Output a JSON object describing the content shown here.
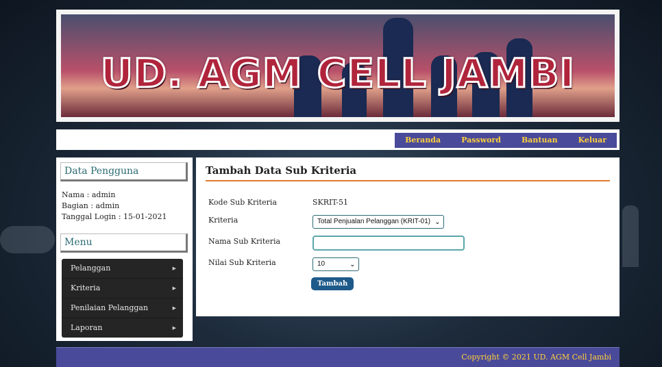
{
  "banner": {
    "title": "UD. AGM CELL JAMBI"
  },
  "nav": {
    "items": [
      {
        "label": "Beranda"
      },
      {
        "label": "Password"
      },
      {
        "label": "Bantuan"
      },
      {
        "label": "Keluar"
      }
    ]
  },
  "sidebar": {
    "user_heading": "Data Pengguna",
    "nama": "Nama : admin",
    "bagian": "Bagian : admin",
    "login": "Tanggal Login : 15-01-2021",
    "menu_heading": "Menu",
    "menu": [
      {
        "label": "Pelanggan",
        "icon": "caret-right-icon"
      },
      {
        "label": "Kriteria",
        "icon": "caret-right-icon"
      },
      {
        "label": "Penilaian Pelanggan",
        "icon": "caret-right-icon"
      },
      {
        "label": "Laporan",
        "icon": "caret-right-icon"
      }
    ]
  },
  "form": {
    "title": "Tambah Data Sub Kriteria",
    "kode_label": "Kode Sub Kriteria",
    "kode_value": "SKRIT-51",
    "kriteria_label": "Kriteria",
    "kriteria_value": "Total Penjualan Pelanggan (KRIT-01)",
    "nama_label": "Nama Sub Kriteria",
    "nama_value": "",
    "nilai_label": "Nilai Sub Kriteria",
    "nilai_value": "10",
    "submit_label": "Tambah"
  },
  "footer": {
    "text": "Copyright © 2021 UD. AGM Cell Jambi"
  },
  "colors": {
    "nav_bg": "#4a4a9a",
    "nav_text": "#ffd23a",
    "accent_rule": "#e07a2a",
    "button": "#1e5a8a",
    "heading_text": "#2a6a72"
  }
}
